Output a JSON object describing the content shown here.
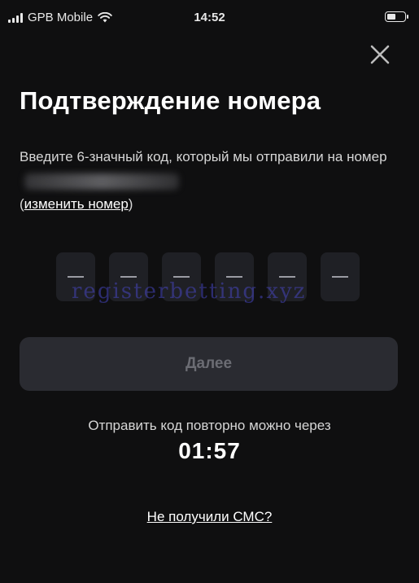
{
  "status_bar": {
    "carrier": "GPB Mobile",
    "time": "14:52",
    "signal_icon": "signal-bars-icon",
    "wifi_icon": "wifi-icon",
    "battery_icon": "battery-icon",
    "battery_level": 0.55
  },
  "header": {
    "close_icon": "close-icon",
    "title": "Подтверждение номера"
  },
  "description": {
    "text": "Введите 6-значный код, который мы отправили на номер ",
    "change_link_open": "(",
    "change_link": "изменить номер",
    "change_link_close": ")"
  },
  "code_input": {
    "length": 6,
    "digits": [
      "",
      "",
      "",
      "",
      "",
      ""
    ]
  },
  "watermark": "registerbetting.xyz",
  "next_button": {
    "label": "Далее",
    "enabled": false
  },
  "resend": {
    "text": "Отправить код повторно можно через",
    "timer": "01:57"
  },
  "no_sms_link": "Не получили СМС?",
  "colors": {
    "background": "#0f0f10",
    "box": "#1f2025",
    "button_disabled": "#2a2b31",
    "button_text_disabled": "#6b6c73"
  }
}
